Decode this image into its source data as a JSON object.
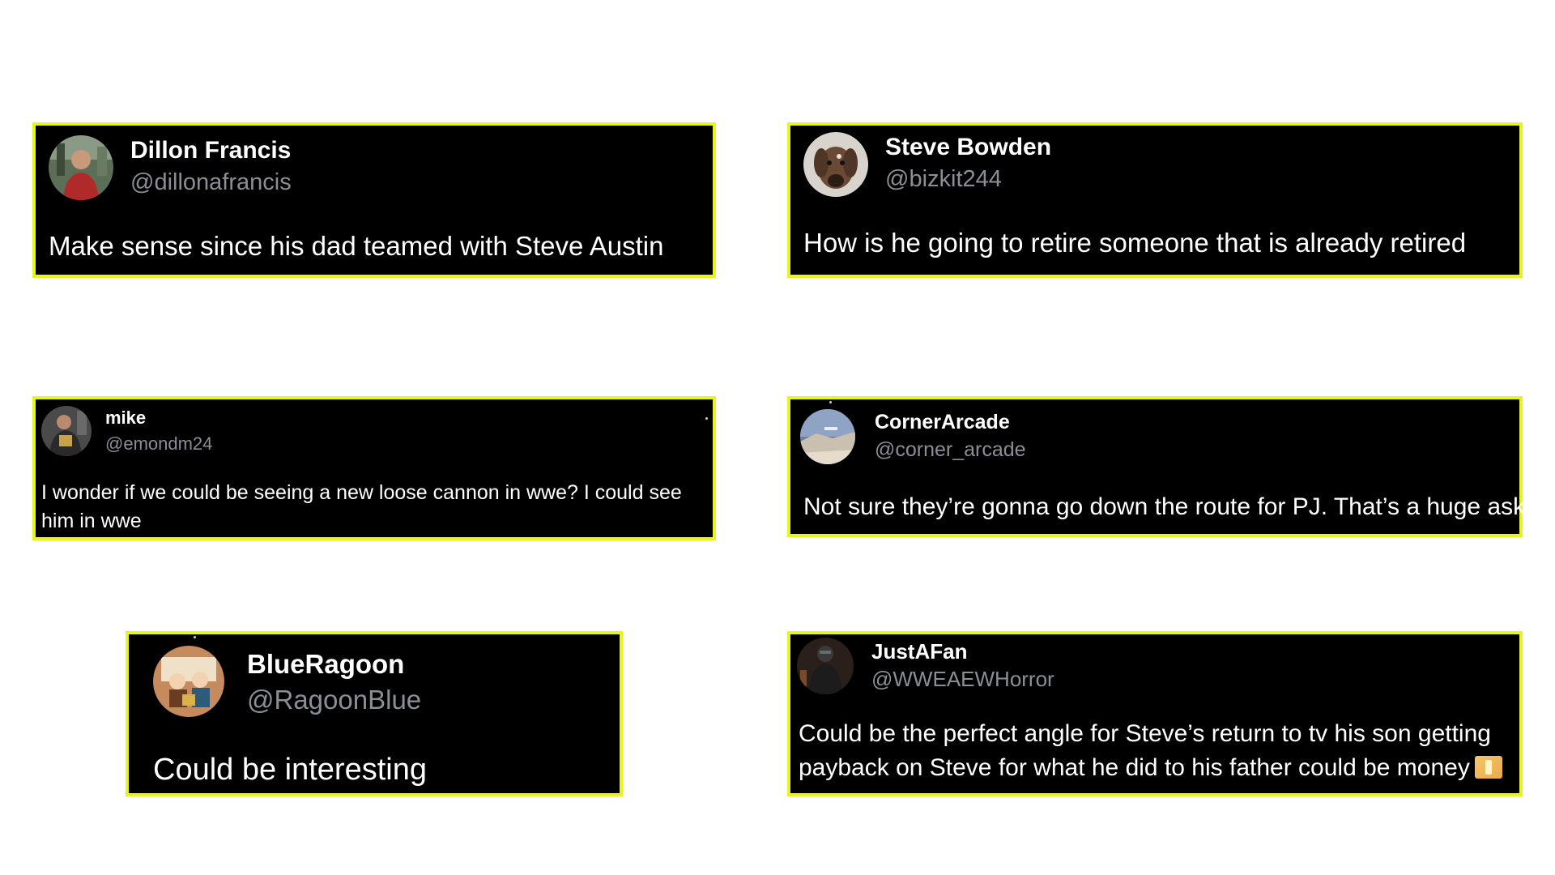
{
  "tweets": [
    {
      "name": "Dillon Francis",
      "handle": "@dillonafrancis",
      "text": "Make sense since his dad teamed with Steve Austin",
      "avatar_icon": "profile-photo-person-red-shirt"
    },
    {
      "name": "Steve Bowden",
      "handle": "@bizkit244",
      "text": "How is he going to retire someone that is already retired",
      "avatar_icon": "profile-photo-dog"
    },
    {
      "name": "mike",
      "handle": "@emondm24",
      "text": "I wonder if we could be seeing a new loose cannon in wwe?  I could see him in wwe",
      "avatar_icon": "profile-photo-wrestler"
    },
    {
      "name": "CornerArcade",
      "handle": "@corner_arcade",
      "text": "Not sure they’re gonna go down the route for PJ. That’s a huge ask",
      "avatar_icon": "profile-photo-landscape"
    },
    {
      "name": "BlueRagoon",
      "handle": "@RagoonBlue",
      "text": "Could be interesting",
      "avatar_icon": "profile-photo-cartoon-family"
    },
    {
      "name": "JustAFan",
      "handle": "@WWEAEWHorror",
      "text": "Could be the perfect angle for Steve’s return to tv his son getting payback on Steve for what he did to his father could be money",
      "avatar_icon": "profile-photo-masked-figure",
      "emoji_icon": "money-emoji-icon"
    }
  ],
  "colors": {
    "card_background": "#000000",
    "card_border": "#e8f51c",
    "name_text": "#ffffff",
    "handle_text": "#8b8f94",
    "page_background": "#ffffff"
  }
}
